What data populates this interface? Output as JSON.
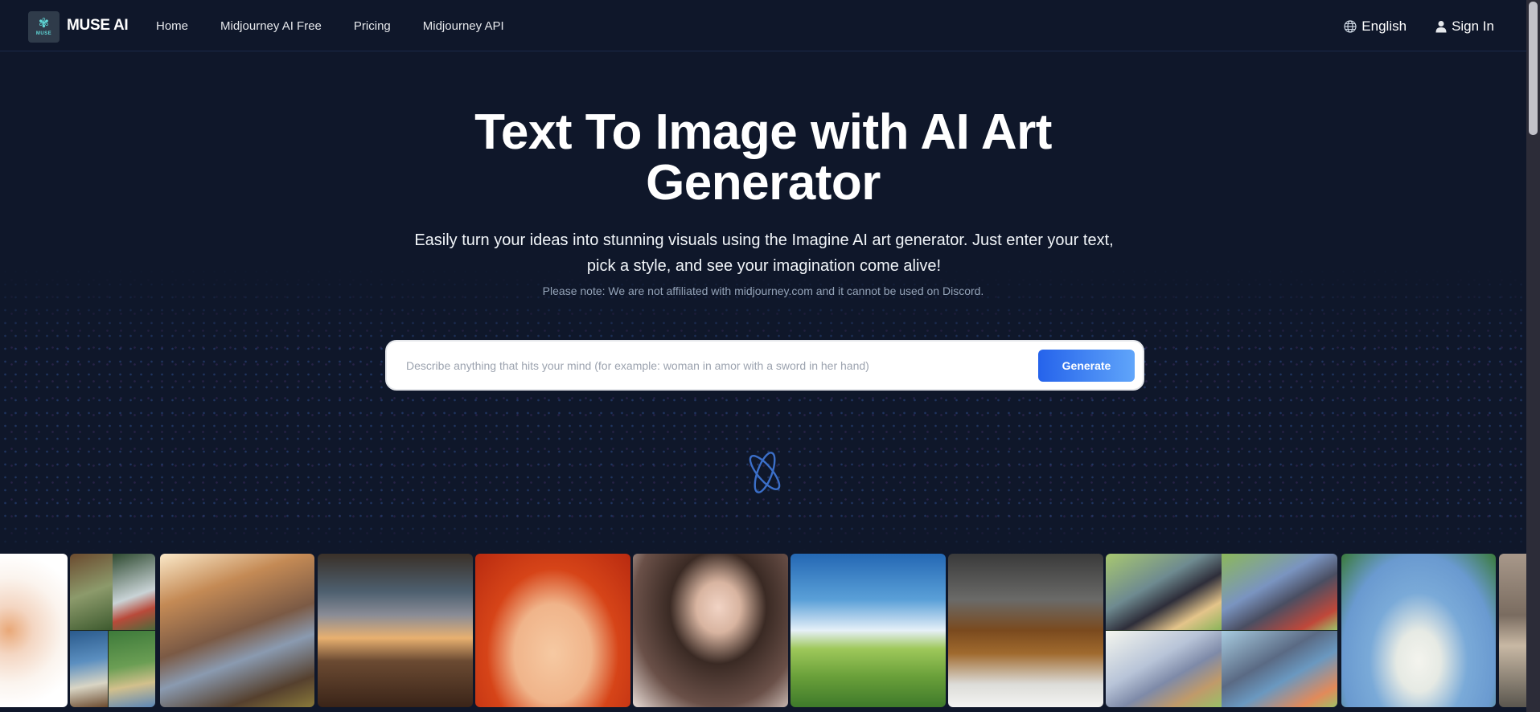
{
  "header": {
    "logo_text": "MUSE",
    "brand": "MUSE AI",
    "nav": [
      {
        "label": "Home"
      },
      {
        "label": "Midjourney AI Free"
      },
      {
        "label": "Pricing"
      },
      {
        "label": "Midjourney API"
      }
    ],
    "language": {
      "label": "English",
      "icon": "globe-icon"
    },
    "sign_in": {
      "label": "Sign In",
      "icon": "user-icon"
    }
  },
  "hero": {
    "title_line1": "Text To Image with AI Art",
    "title_line2": "Generator",
    "subtitle": "Easily turn your ideas into stunning visuals using the Imagine AI art generator. Just enter your text, pick a style, and see your imagination come alive!",
    "note": "Please note: We are not affiliated with midjourney.com and it cannot be used on Discord."
  },
  "search": {
    "value": "",
    "placeholder": "Describe anything that hits your mind (for example: woman in amor with a sword in her hand)",
    "button_label": "Generate"
  },
  "loading": {
    "icon": "orbit-spinner-icon"
  },
  "gallery": {
    "items": [
      {
        "name": "watercolor-children-image",
        "subject": "watercolor children"
      },
      {
        "name": "anime-boys-with-dogs-grid-image",
        "subject": "anime boys with dogs (4-grid)"
      },
      {
        "name": "archer-girl-sunset-image",
        "subject": "blonde archer girl at sunset"
      },
      {
        "name": "astronaut-room-sunset-image",
        "subject": "astronaut in room watching sunset"
      },
      {
        "name": "red-hair-anime-girl-image",
        "subject": "red-haired anime girl"
      },
      {
        "name": "dark-hair-anime-woman-image",
        "subject": "long dark-haired anime woman"
      },
      {
        "name": "rocket-tower-meadow-image",
        "subject": "rocket tower on green hill"
      },
      {
        "name": "essential-oil-bottles-image",
        "subject": "essential oil bottles"
      },
      {
        "name": "wolf-picnic-grid-image",
        "subject": "anime wolves picnic (4-grid)"
      },
      {
        "name": "petals-boy-sky-image",
        "subject": "boy in falling petals"
      },
      {
        "name": "modern-interior-image",
        "subject": "modern interior"
      }
    ]
  },
  "colors": {
    "background": "#0f172a",
    "button_gradient_start": "#2563eb",
    "button_gradient_end": "#60a5fa",
    "logo_accent": "#5fd6d6",
    "note_text": "#94a3b8"
  }
}
